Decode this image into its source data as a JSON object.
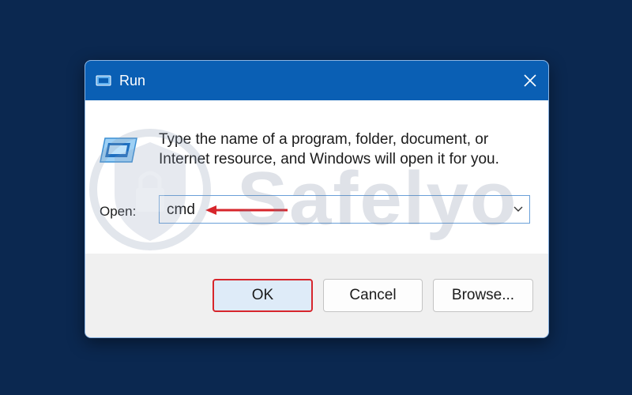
{
  "window": {
    "title": "Run",
    "title_icon": "run-icon",
    "close_icon": "close-icon"
  },
  "content": {
    "app_icon": "run-app-icon",
    "description": "Type the name of a program, folder, document, or Internet resource, and Windows will open it for you.",
    "open_label": "Open:",
    "open_value": "cmd",
    "dropdown_icon": "chevron-down-icon",
    "annotation_icon": "red-arrow-icon"
  },
  "buttons": {
    "ok": "OK",
    "cancel": "Cancel",
    "browse": "Browse..."
  },
  "watermark": {
    "text": "Safelyo",
    "icon": "shield-lock-icon"
  },
  "colors": {
    "background": "#0b2850",
    "titlebar": "#0a5fb4",
    "highlight_border": "#d7262c",
    "annotation_arrow": "#d7262c"
  }
}
